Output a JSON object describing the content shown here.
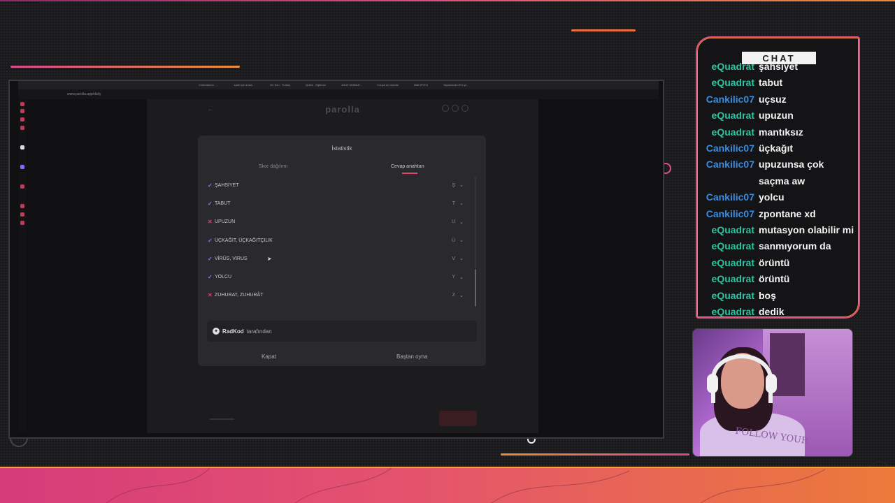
{
  "browser": {
    "tabs": [
      "Codenames - ...",
      "sarki için ananı...",
      "En Son - Turkey",
      "Quibe - Eğlence",
      "JOUX MOBILE -",
      "Coupe du monde",
      "ZNE.IP.IFU",
      "Yapamazsın En iyi..."
    ],
    "address": "www.parolla.app/daily"
  },
  "page": {
    "logo": "parolla"
  },
  "modal": {
    "title": "İstatistik",
    "tabs": [
      {
        "label": "Skor dağılımı",
        "active": false
      },
      {
        "label": "Cevap anahtarı",
        "active": true
      }
    ],
    "answers": [
      {
        "word": "ŞAHSİYET",
        "letter": "Ş",
        "correct": true
      },
      {
        "word": "TABUT",
        "letter": "T",
        "correct": true
      },
      {
        "word": "UPUZUN",
        "letter": "U",
        "correct": false
      },
      {
        "word": "ÜÇKAĞIT, ÜÇKAĞITÇILIK",
        "letter": "Ü",
        "correct": true
      },
      {
        "word": "VİRÜS, VIRUS",
        "letter": "V",
        "correct": true
      },
      {
        "word": "YOLCU",
        "letter": "Y",
        "correct": true
      },
      {
        "word": "ZUHURAT, ZUHURÂT",
        "letter": "Z",
        "correct": false
      }
    ],
    "credit_author": "RadKod",
    "credit_suffix": "tarafından",
    "close_label": "Kapat",
    "restart_label": "Baştan oyna"
  },
  "chat": {
    "header": "CHAT",
    "colors": {
      "eQuadrat": "#2ec4a0",
      "Cankilic07": "#3a8de0"
    },
    "messages": [
      {
        "user": "eQuadrat",
        "text": "şahsiyet"
      },
      {
        "user": "eQuadrat",
        "text": "tabut"
      },
      {
        "user": "Cankilic07",
        "text": "uçsuz"
      },
      {
        "user": "eQuadrat",
        "text": "upuzun"
      },
      {
        "user": "eQuadrat",
        "text": "mantıksız"
      },
      {
        "user": "Cankilic07",
        "text": "üçkağıt"
      },
      {
        "user": "Cankilic07",
        "text": "upuzunsa çok saçma aw"
      },
      {
        "user": "Cankilic07",
        "text": "yolcu"
      },
      {
        "user": "Cankilic07",
        "text": "zpontane xd"
      },
      {
        "user": "eQuadrat",
        "text": "mutasyon olabilir mi"
      },
      {
        "user": "eQuadrat",
        "text": "sanmıyorum da"
      },
      {
        "user": "eQuadrat",
        "text": "örüntü"
      },
      {
        "user": "eQuadrat",
        "text": "örüntü"
      },
      {
        "user": "eQuadrat",
        "text": "boş"
      },
      {
        "user": "eQuadrat",
        "text": "dedik"
      }
    ]
  },
  "webcam": {
    "shirt_text": "FOLLOW YOUR"
  }
}
